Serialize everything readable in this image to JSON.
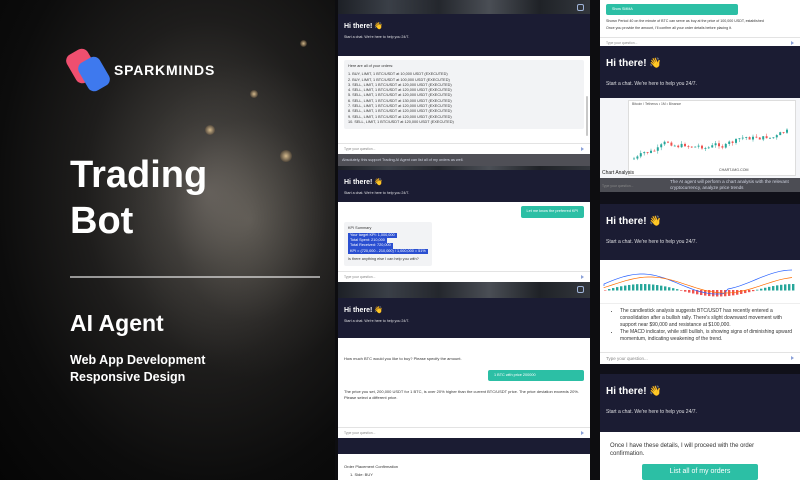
{
  "brand": {
    "name": "SPARKMINDS"
  },
  "hero": {
    "title_line1": "Trading",
    "title_line2": "Bot",
    "subtitle": "AI Agent",
    "tag1": "Web App Development",
    "tag2": "Responsive Design"
  },
  "chat": {
    "greeting": "Hi there!",
    "wave": "👋",
    "start_text": "Start a chat. We're here to help you 24/7.",
    "input_placeholder": "Type your question..."
  },
  "mid": {
    "card1": {
      "intro": "Here are all of your orders:",
      "orders": [
        "1. BUY, LIMIT, 1 BTC/USDT at 10,000 USDT (EXECUTED)",
        "2. BUY, LIMIT, 1 BTC/USDT at 100,000 USDT (EXECUTED)",
        "3. SELL, LIMIT, 1 BTC/USDT at 120,000 USDT (EXECUTED)",
        "4. SELL, LIMIT, 1 BTC/USDT at 120,000 USDT (EXECUTED)",
        "5. SELL, LIMIT, 1 BTC/USDT at 120,000 USDT (EXECUTED)",
        "6. SELL, LIMIT, 1 BTC/USDT at 130,000 USDT (EXECUTED)",
        "7. SELL, LIMIT, 1 BTC/USDT at 120,000 USDT (EXECUTED)",
        "8. SELL, LIMIT, 1 BTC/USDT at 120,000 USDT (EXECUTED)",
        "9. SELL, LIMIT, 1 BTC/USDT at 120,000 USDT (EXECUTED)",
        "10. SELL, LIMIT, 1 BTC/USDT at 120,000 USDT (EXECUTED)"
      ],
      "caption": "Absolutely, this support Trading AI Agent can list all of my orders as well."
    },
    "card2": {
      "user_msg": "Let me know the preferred KPI",
      "kpi_title": "KPI Summary",
      "kpis": [
        "Your target KPI: 1,000,000",
        "Total Spent: 210,000",
        "Total Received: 720,000",
        "KPI = (720,000 - 210,000) / 1,000,000 = 51%"
      ],
      "followup": "Is there anything else I can help you with?"
    },
    "card3": {
      "question": "How much BTC would you like to buy? Please specify the amount.",
      "user_msg": "1 BTC with price 200000",
      "reply": "The price you set, 200,000 USDT for 1 BTC, is over 20% higher than the current BTC/USDT price. The price deviation exceeds 20%. Please select a different price."
    },
    "card4": {
      "title": "Order Placement Confirmation",
      "line": "1. Side: BUY"
    }
  },
  "right": {
    "card1": {
      "user_msg": "Show SMMA",
      "reply": "Shown Period 40 on the minute of BTC can serve as buy at the price of 100,000 USDT, established",
      "reply2": "Once you provide the amount, I'll confirm all your order details before placing it."
    },
    "card2": {
      "chart_label": "Bitcoin / Tetherus • 1M • Binance",
      "caption_title": "Chart Analysis",
      "caption_text": "The AI agent will perform a chart analysis with the relevant cryptocurrency, analyze price trends",
      "watermark": "CHART-IMG.COM"
    },
    "card3": {
      "bullets": [
        "The candlestick analysis suggests BTC/USDT has recently entered a consolidation after a bullish rally. There's slight downward movement with support near $90,000 and resistance at $100,000.",
        "The MACD indicator, while still bullish, is showing signs of diminishing upward momentum, indicating weakening of the trend."
      ]
    },
    "card4": {
      "text": "Once I have these details, I will proceed with the order confirmation.",
      "button": "List all of my orders"
    }
  },
  "colors": {
    "accent_teal": "#2cbfa5",
    "header_navy": "#1b1c33",
    "logo_red": "#ef4f6f",
    "logo_blue": "#3e79ee"
  }
}
